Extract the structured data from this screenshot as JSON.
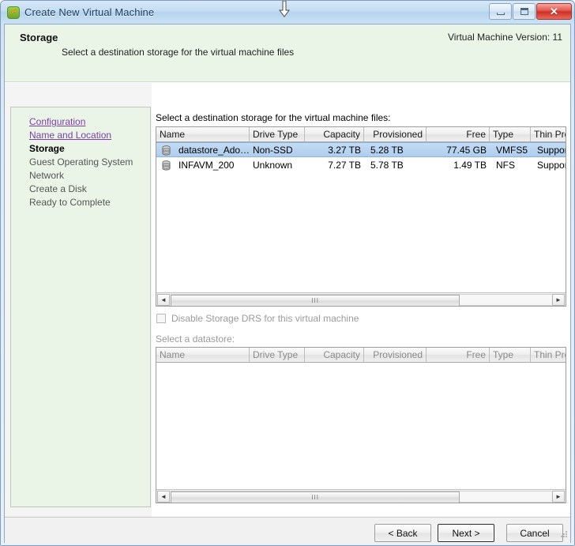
{
  "window": {
    "title": "Create New Virtual Machine",
    "icon": "vm-wizard-icon",
    "minimize_label": "Minimize",
    "maximize_label": "Maximize",
    "close_label": "Close",
    "close_glyph": "✕"
  },
  "header": {
    "title": "Storage",
    "subtitle": "Select a destination storage for the virtual machine files",
    "version": "Virtual Machine Version: 11"
  },
  "sidebar": {
    "items": [
      {
        "label": "Configuration",
        "state": "link"
      },
      {
        "label": "Name and Location",
        "state": "link"
      },
      {
        "label": "Storage",
        "state": "current"
      },
      {
        "label": "Guest Operating System",
        "state": "dim"
      },
      {
        "label": "Network",
        "state": "dim"
      },
      {
        "label": "Create a Disk",
        "state": "dim"
      },
      {
        "label": "Ready to Complete",
        "state": "dim"
      }
    ]
  },
  "main": {
    "select_label": "Select a destination storage for the virtual machine files:",
    "datastore_label": "Select a datastore:",
    "disable_drs_label": "Disable Storage DRS for this virtual machine",
    "disable_drs_checked": false,
    "disable_drs_enabled": false
  },
  "table": {
    "columns": [
      {
        "label": "Name",
        "align": "left"
      },
      {
        "label": "Drive Type",
        "align": "left"
      },
      {
        "label": "Capacity",
        "align": "right"
      },
      {
        "label": "Provisioned",
        "align": "right"
      },
      {
        "label": "Free",
        "align": "right"
      },
      {
        "label": "Type",
        "align": "left"
      },
      {
        "label": "Thin Prov",
        "align": "left"
      }
    ],
    "rows": [
      {
        "icon": "datastore-icon",
        "name": "datastore_Ado…",
        "drive_type": "Non-SSD",
        "capacity": "3.27 TB",
        "provisioned": "5.28 TB",
        "free": "77.45 GB",
        "type": "VMFS5",
        "thin": "Supporte",
        "selected": true
      },
      {
        "icon": "datastore-icon",
        "name": "INFAVM_200",
        "drive_type": "Unknown",
        "capacity": "7.27 TB",
        "provisioned": "5.78 TB",
        "free": "1.49 TB",
        "type": "NFS",
        "thin": "Supporte",
        "selected": false
      }
    ]
  },
  "table2": {
    "columns": [
      {
        "label": "Name",
        "align": "left"
      },
      {
        "label": "Drive Type",
        "align": "left"
      },
      {
        "label": "Capacity",
        "align": "right"
      },
      {
        "label": "Provisioned",
        "align": "right"
      },
      {
        "label": "Free",
        "align": "right"
      },
      {
        "label": "Type",
        "align": "left"
      },
      {
        "label": "Thin Provi",
        "align": "left"
      }
    ],
    "rows": []
  },
  "scrollbars": {
    "left_arrow": "◄",
    "right_arrow": "►",
    "grip": "III"
  },
  "footer": {
    "back_label": "< Back",
    "next_label": "Next >",
    "cancel_label": "Cancel"
  },
  "colors": {
    "selection": "#aecdee",
    "sidebar_bg": "#eaf5e8",
    "link": "#7a3fa8",
    "close_red": "#cc2f22"
  }
}
